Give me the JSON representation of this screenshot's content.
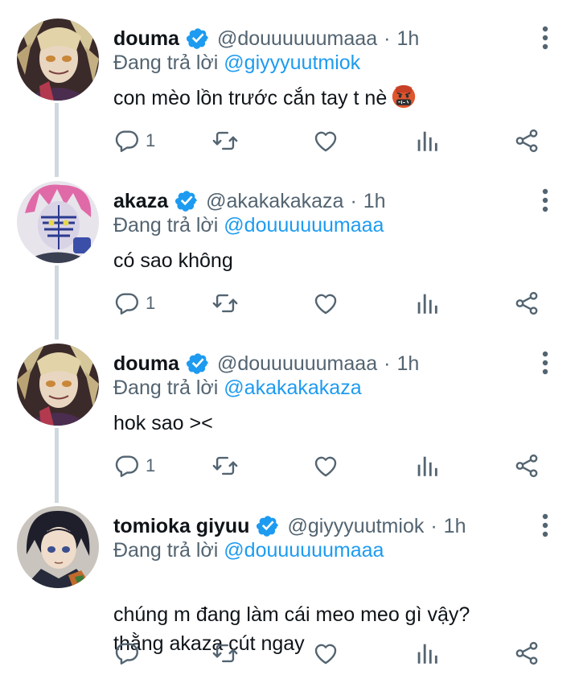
{
  "colors": {
    "accent": "#1d9bf0",
    "secondary_text": "#536471",
    "thread_line": "#cfd9de"
  },
  "replying_prefix": "Đang trả lời",
  "tweets": [
    {
      "name": "douma",
      "handle": "@douuuuuumaaa",
      "separator": "·",
      "time": "1h",
      "reply_to": "@giyyyuutmiok",
      "text": "con mèo lồn trước cắn tay t nè",
      "emoji": "face-with-symbols-on-mouth",
      "reply_count": "1",
      "avatar": "douma-avatar"
    },
    {
      "name": "akaza",
      "handle": "@akakakakaza",
      "separator": "·",
      "time": "1h",
      "reply_to": "@douuuuuumaaa",
      "text": "có sao không",
      "reply_count": "1",
      "avatar": "akaza-avatar"
    },
    {
      "name": "douma",
      "handle": "@douuuuuumaaa",
      "separator": "·",
      "time": "1h",
      "reply_to": "@akakakakaza",
      "text": "hok sao ><",
      "reply_count": "1",
      "avatar": "douma-avatar"
    },
    {
      "name": "tomioka giyuu",
      "handle": "@giyyyuutmiok",
      "separator": "·",
      "time": "1h",
      "reply_to": "@douuuuuumaaa",
      "text": "chúng m đang làm cái meo meo gì vậy?\nthằng akaza cút ngay",
      "reply_count": "",
      "avatar": "giyuu-avatar"
    }
  ],
  "icons": {
    "verified": "verified-badge-icon",
    "more": "more-vertical-icon",
    "reply": "reply-bubble-icon",
    "retweet": "retweet-icon",
    "like": "heart-icon",
    "views": "views-bar-chart-icon",
    "share": "share-icon"
  }
}
